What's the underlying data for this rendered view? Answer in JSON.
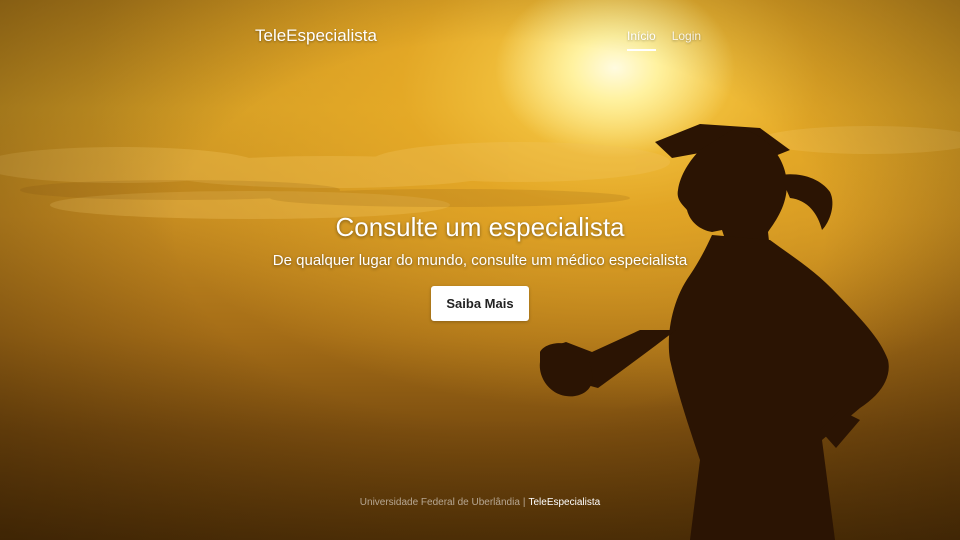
{
  "header": {
    "brand": "TeleEspecialista",
    "nav": [
      {
        "label": "Início",
        "active": true
      },
      {
        "label": "Login",
        "active": false
      }
    ]
  },
  "hero": {
    "title": "Consulte um especialista",
    "subtitle": "De qualquer lugar do mundo, consulte um médico especialista",
    "button_label": "Saiba Mais"
  },
  "footer": {
    "university": "Universidade Federal de Uberlândia",
    "separator": "|",
    "link": "TeleEspecialista"
  },
  "background": {
    "description_icon": "runner-silhouette-sunset-image",
    "accent": "#d9a12c"
  }
}
